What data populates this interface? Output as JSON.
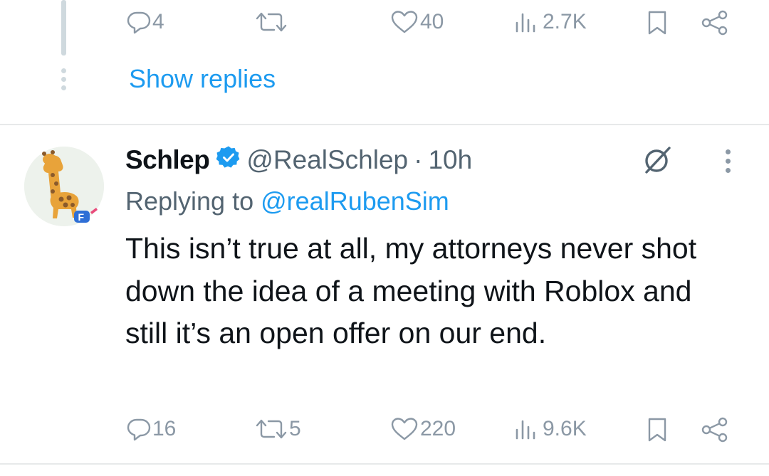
{
  "previous_tweet": {
    "actions": {
      "reply_count": "4",
      "repost_count": "",
      "like_count": "40",
      "view_count": "2.7K"
    },
    "show_replies_label": "Show replies"
  },
  "tweet": {
    "display_name": "Schlep",
    "handle": "@RealSchlep",
    "separator": "·",
    "time": "10h",
    "replying_prefix": "Replying to",
    "replying_to": "@realRubenSim",
    "text": "This isn’t true at all, my attorneys never shot down the idea of a meeting with Roblox and still it’s an open offer on our end.",
    "actions": {
      "reply_count": "16",
      "repost_count": "5",
      "like_count": "220",
      "view_count": "9.6K"
    }
  },
  "icons": {
    "reply": "speech-bubble-icon",
    "repost": "repost-arrows-icon",
    "like": "heart-icon",
    "views": "bar-chart-icon",
    "bookmark": "bookmark-icon",
    "share": "share-nodes-icon",
    "verified": "verified-badge-icon",
    "grok": "grok-icon",
    "more": "more-vertical-icon"
  },
  "colors": {
    "link_blue": "#1d9bf0",
    "muted_gray": "#8b98a5",
    "secondary_text": "#536471",
    "divider": "#e7e9ea"
  }
}
